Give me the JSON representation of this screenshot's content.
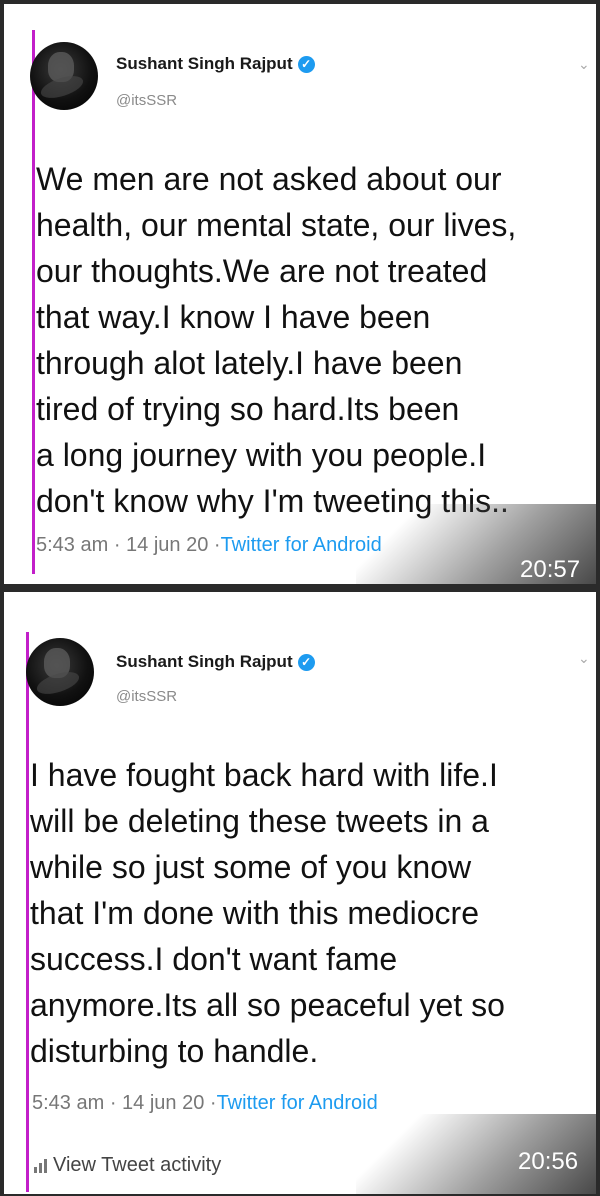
{
  "tweets": [
    {
      "author": "Sushant Singh Rajput",
      "handle": "@itsSSR",
      "text": "We men are not asked about our\nhealth, our mental state, our lives,\nour thoughts.We are not treated\nthat way.I know I have been\nthrough alot lately.I have been\ntired of trying so hard.Its been\na long journey with you people.I\ndon't know why I'm tweeting this..",
      "timestamp": "5:43 am · 14 jun 20 ·",
      "source": "Twitter for Android",
      "clock": "20:57"
    },
    {
      "author": "Sushant Singh Rajput",
      "handle": "@itsSSR",
      "text": "I have fought back hard with life.I\nwill be deleting these tweets in a\nwhile so just some of you know\nthat I'm done with this mediocre\nsuccess.I don't want fame\nanymore.Its all so peaceful yet so\ndisturbing to handle.",
      "timestamp": "5:43 am · 14 jun 20 ·",
      "source": "Twitter for Android",
      "clock": "20:56",
      "activity_label": "View Tweet activity"
    }
  ],
  "icons": {
    "verified": "verified-badge-icon",
    "caret": "chevron-down-icon",
    "activity": "bar-chart-icon"
  },
  "colors": {
    "accent_line": "#c21fc9",
    "link": "#1d9bf0",
    "verified": "#1d9bf0"
  }
}
